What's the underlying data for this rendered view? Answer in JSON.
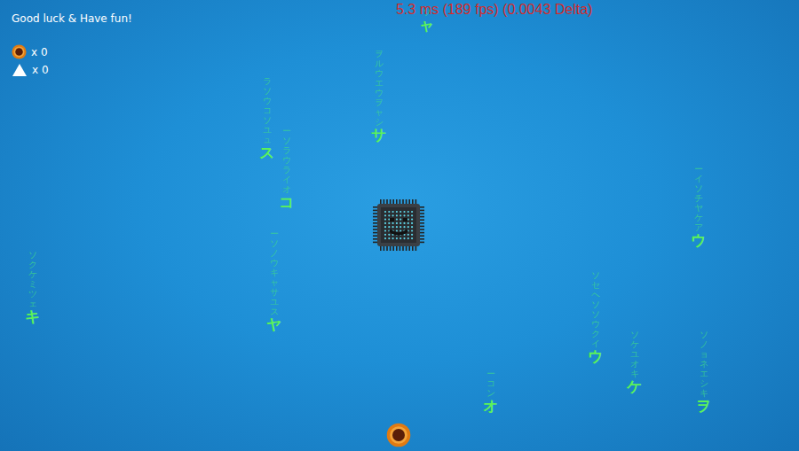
{
  "hud": {
    "greeting": "Good luck & Have fun!",
    "counters": [
      {
        "kind": "coin",
        "value": "x 0"
      },
      {
        "kind": "triangle",
        "value": "x 0"
      }
    ]
  },
  "stats": "5.3 ms (189 fps) (0.0043 Delta)",
  "rain": [
    {
      "trail": "ソ",
      "head": "ャ"
    },
    {
      "trail": "ヲルウエウヲャシ",
      "head": "サ"
    },
    {
      "trail": "ラソウコソユュ",
      "head": "ス"
    },
    {
      "trail": "ーソラウライオ",
      "head": "コ"
    },
    {
      "trail": "ーソノウキャサユス",
      "head": "ヤ"
    },
    {
      "trail": "ソクケミツェ",
      "head": "キ"
    },
    {
      "trail": "ーイソチヤケア",
      "head": "ウ"
    },
    {
      "trail": "ソセヘソソウクイ",
      "head": "ウ"
    },
    {
      "trail": "ソケユオキ",
      "head": "ケ"
    },
    {
      "trail": "ーコン",
      "head": "オ"
    },
    {
      "trail": "ソノョネエシキ",
      "head": "ヲ"
    }
  ]
}
